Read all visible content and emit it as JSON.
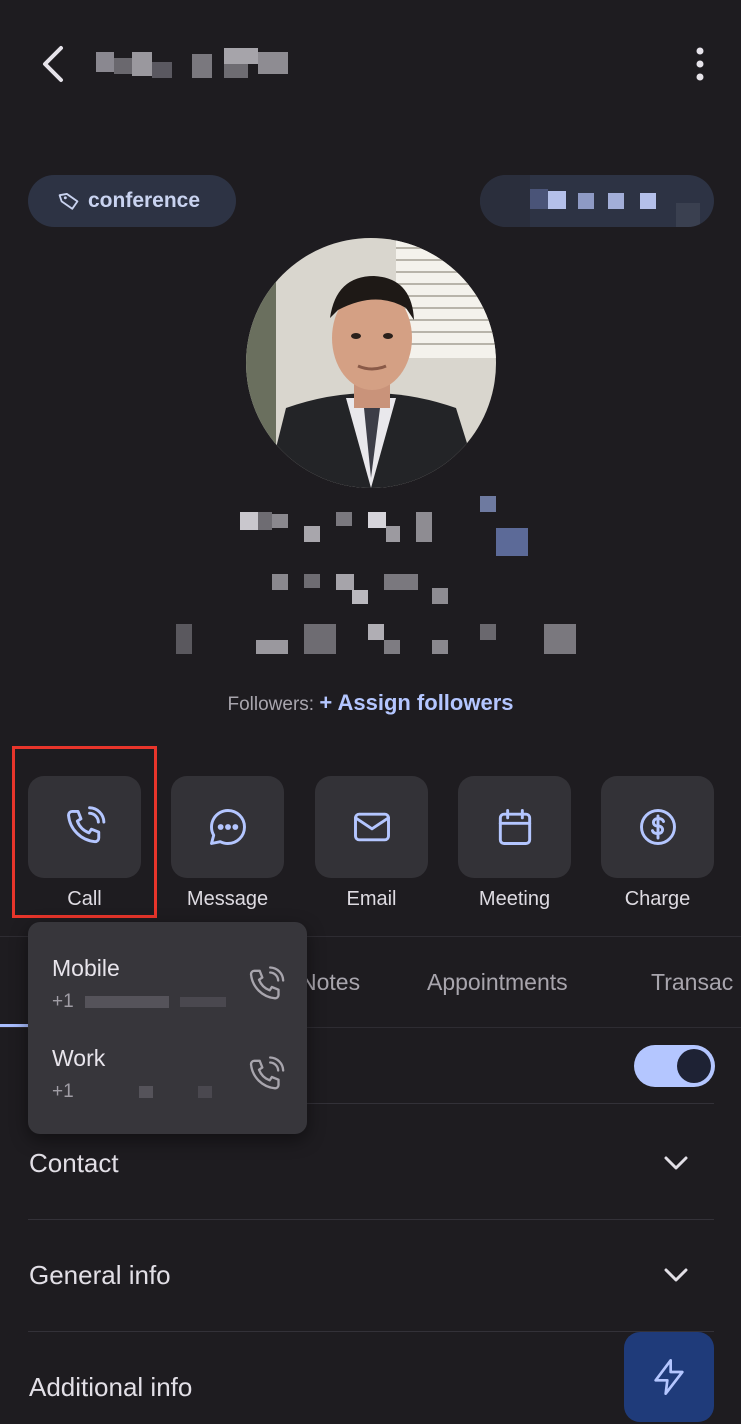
{
  "header": {
    "back_icon": "chevron-left-icon",
    "more_icon": "more-vertical-icon"
  },
  "tag": {
    "label": "conference",
    "icon": "tag-icon"
  },
  "followers": {
    "label": "Followers:",
    "assign": "+ Assign followers"
  },
  "actions": [
    {
      "label": "Call",
      "icon": "phone-icon"
    },
    {
      "label": "Message",
      "icon": "message-icon"
    },
    {
      "label": "Email",
      "icon": "mail-icon"
    },
    {
      "label": "Meeting",
      "icon": "calendar-icon"
    },
    {
      "label": "Charge",
      "icon": "dollar-icon"
    }
  ],
  "tabs": [
    "Notes",
    "Appointments",
    "Transac"
  ],
  "sections": [
    "Contact",
    "General info",
    "Additional info"
  ],
  "call_menu": [
    {
      "label": "Mobile",
      "number_prefix": "+1"
    },
    {
      "label": "Work",
      "number_prefix": "+1"
    }
  ],
  "colors": {
    "accent": "#b4c6ff",
    "highlight": "#e8352b",
    "fab": "#1f3b7a"
  }
}
